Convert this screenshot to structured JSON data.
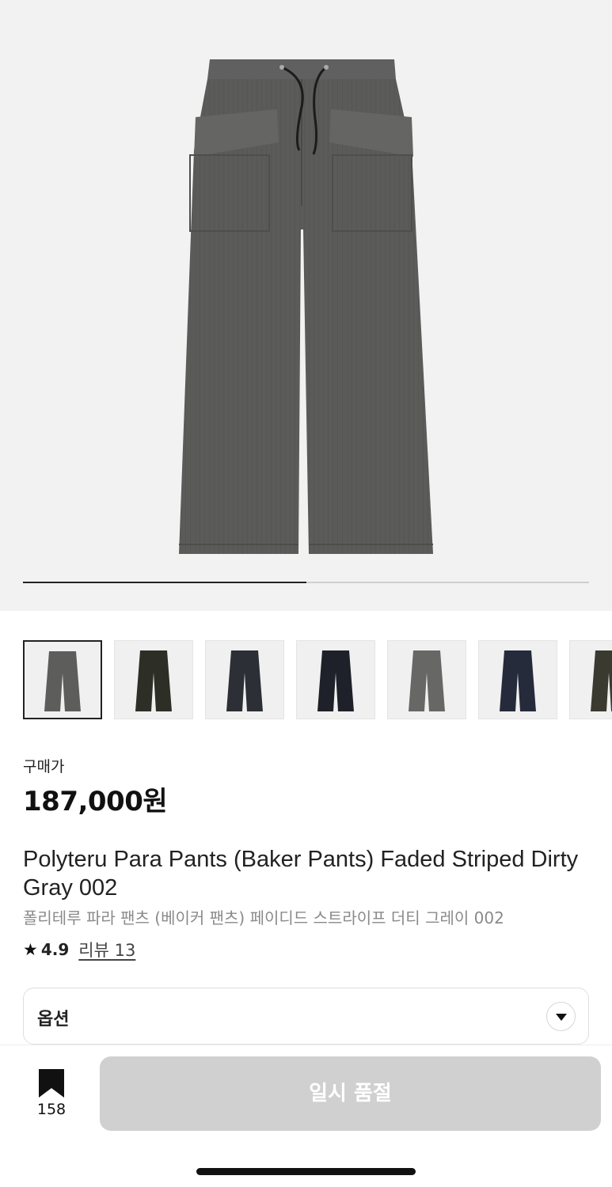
{
  "hero": {
    "image": "product-photo-pants-dirty-gray",
    "pager": {
      "current": 1,
      "total": 2
    }
  },
  "thumbnails": [
    {
      "color": "#5d5d5b",
      "selected": true
    },
    {
      "color": "#2d2e26",
      "selected": false
    },
    {
      "color": "#2c2f35",
      "selected": false
    },
    {
      "color": "#1e2129",
      "selected": false
    },
    {
      "color": "#676765",
      "selected": false
    },
    {
      "color": "#262b3b",
      "selected": false
    },
    {
      "color": "#3b3a30",
      "selected": false
    }
  ],
  "product": {
    "price_label": "구매가",
    "price": "187,000원",
    "title_en": "Polyteru Para Pants (Baker Pants) Faded Striped Dirty Gray 002",
    "title_ko": "폴리테루 파라 팬츠 (베이커 팬츠) 페이디드 스트라이프 더티 그레이 002",
    "rating": "4.9",
    "reviews": "리뷰 13"
  },
  "option": {
    "label": "옵션",
    "icon": "dropdown-arrow-icon"
  },
  "bottom_bar": {
    "bookmark_icon": "bookmark-icon",
    "bookmark_count": "158",
    "soldout_label": "일시 품절"
  },
  "colors": {
    "accent": "#222222",
    "disabled_button": "#d0d0d0",
    "subtext": "#8a8a8a"
  }
}
